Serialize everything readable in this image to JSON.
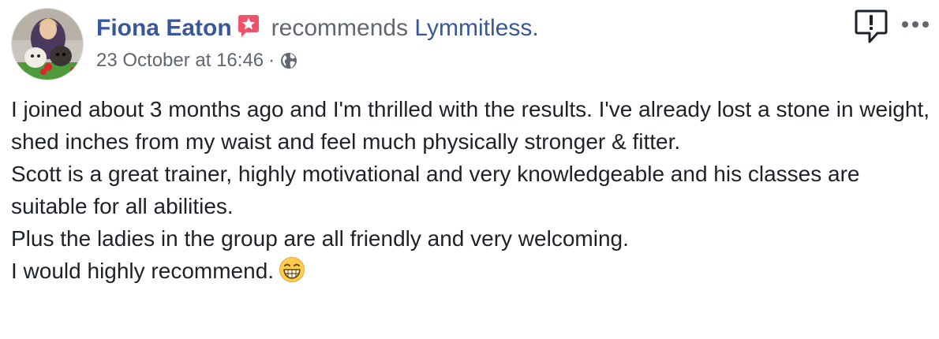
{
  "post": {
    "author": "Fiona Eaton",
    "verb": "recommends",
    "page": "Lymmitless.",
    "timestamp": "23 October at 16:46",
    "separator": "·",
    "privacy_icon": "globe-icon",
    "recommendation_icon": "star-badge-icon",
    "paragraphs": [
      "I joined about 3 months ago and I'm thrilled with the results. I've already lost a stone in weight, shed inches from my waist and feel much physically stronger & fitter.",
      "Scott is a great trainer, highly motivational and very knowledgeable and his classes are suitable for all abilities.",
      "Plus the ladies in the group are all friendly and very welcoming.",
      "I would highly recommend."
    ],
    "emoji": "grinning-face-emoji"
  },
  "actions": {
    "report_icon": "report-icon",
    "more_icon": "more-options-icon"
  },
  "colors": {
    "link": "#385898",
    "meta": "#606770",
    "text": "#1d2129",
    "badge": "#f25268"
  }
}
